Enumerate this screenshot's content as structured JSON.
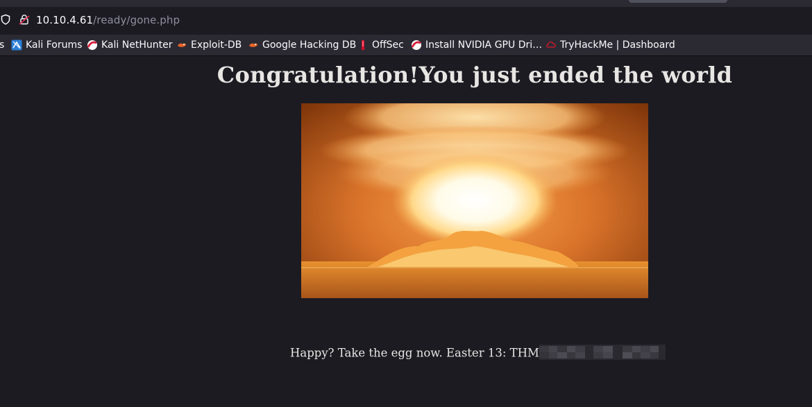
{
  "browser": {
    "url_host": "10.10.4.61",
    "url_path": "/ready/gone.php"
  },
  "bookmarks": [
    {
      "label": "s",
      "icon": "kali-icon"
    },
    {
      "label": "Kali Forums",
      "icon": "kali-forums-icon"
    },
    {
      "label": "Kali NetHunter",
      "icon": "offsec-icon"
    },
    {
      "label": "Exploit-DB",
      "icon": "exploit-db-icon"
    },
    {
      "label": "Google Hacking DB",
      "icon": "exploit-db-icon"
    },
    {
      "label": "OffSec",
      "icon": "offsec-flag-icon"
    },
    {
      "label": "Install NVIDIA GPU Dri…",
      "icon": "offsec-icon"
    },
    {
      "label": "TryHackMe | Dashboard",
      "icon": "tryhackme-icon"
    }
  ],
  "page": {
    "headline": "Congratulation!You just ended the world",
    "message": "Happy? Take the egg now. Easter 13: THM"
  },
  "colors": {
    "page_bg": "#1c1b22",
    "toolbar_bg": "#2b2a33",
    "text": "#e8e6e3"
  }
}
